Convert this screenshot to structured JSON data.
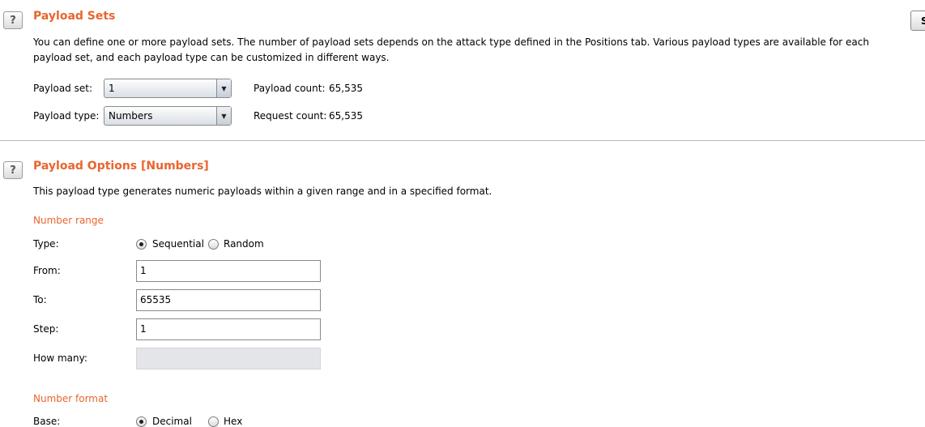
{
  "payload_sets": {
    "help_label": "?",
    "title": "Payload Sets",
    "description": "You can define one or more payload sets. The number of payload sets depends on the attack type defined in the Positions tab. Various payload types are available for each payload set, and each payload type can be customized in different ways.",
    "payload_set_label": "Payload set:",
    "payload_set_value": "1",
    "payload_type_label": "Payload type:",
    "payload_type_value": "Numbers",
    "payload_count_label": "Payload count:",
    "payload_count_value": "65,535",
    "request_count_label": "Request count:",
    "request_count_value": "65,535",
    "edge_button_label": "S"
  },
  "payload_options": {
    "help_label": "?",
    "title": "Payload Options [Numbers]",
    "description": "This payload type generates numeric payloads within a given range and in a specified format.",
    "number_range": {
      "heading": "Number range",
      "type_label": "Type:",
      "type_options": [
        {
          "label": "Sequential",
          "checked": true
        },
        {
          "label": "Random",
          "checked": false
        }
      ],
      "from_label": "From:",
      "from_value": "1",
      "to_label": "To:",
      "to_value": "65535",
      "step_label": "Step:",
      "step_value": "1",
      "how_many_label": "How many:",
      "how_many_value": ""
    },
    "number_format": {
      "heading": "Number format",
      "base_label": "Base:",
      "base_options": [
        {
          "label": "Decimal",
          "checked": true
        },
        {
          "label": "Hex",
          "checked": false
        }
      ]
    }
  },
  "colors": {
    "accent": "#e8652e",
    "disabled_field": "#e3e5e8"
  }
}
